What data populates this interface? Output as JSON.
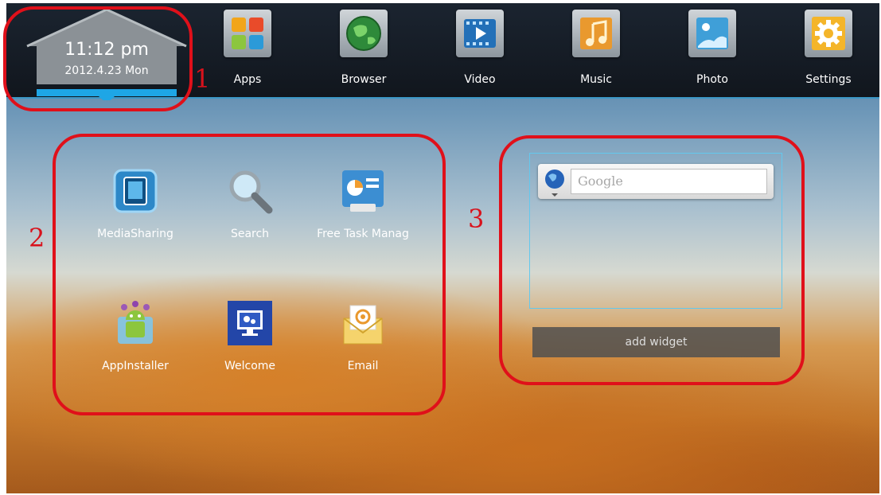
{
  "clock": {
    "time": "11:12 pm",
    "date": "2012.4.23  Mon"
  },
  "dock": [
    {
      "label": "Apps",
      "icon": "apps-icon"
    },
    {
      "label": "Browser",
      "icon": "browser-globe-icon"
    },
    {
      "label": "Video",
      "icon": "video-icon"
    },
    {
      "label": "Music",
      "icon": "music-icon"
    },
    {
      "label": "Photo",
      "icon": "photo-icon"
    },
    {
      "label": "Settings",
      "icon": "settings-gear-icon"
    }
  ],
  "home_apps": [
    {
      "label": "MediaSharing",
      "icon": "media-sharing-icon"
    },
    {
      "label": "Search",
      "icon": "magnifier-icon"
    },
    {
      "label": "Free Task Manag",
      "icon": "task-manager-icon"
    },
    {
      "label": "AppInstaller",
      "icon": "android-installer-icon"
    },
    {
      "label": "Welcome",
      "icon": "welcome-monitor-icon"
    },
    {
      "label": "Email",
      "icon": "email-envelope-icon"
    }
  ],
  "search_widget": {
    "placeholder": "Google"
  },
  "add_widget_label": "add widget",
  "callouts": [
    "1",
    "2",
    "3"
  ],
  "colors": {
    "callout_red": "#e0101a",
    "accent_blue": "#3c98c8",
    "widget_border": "#63c8ee"
  }
}
